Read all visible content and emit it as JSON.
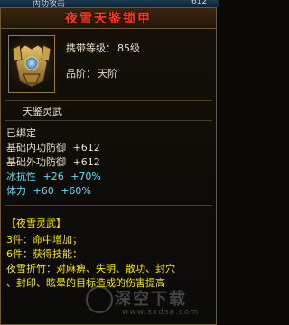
{
  "top_strip": {
    "text": "内功攻击",
    "num": "612"
  },
  "item": {
    "name": "夜雪天鉴锁甲",
    "icon": "armor-icon",
    "level_label": "携带等级：",
    "level_value": "85级",
    "grade_label": "品阶：",
    "grade_value": "天阶",
    "category": "天鉴灵武"
  },
  "stats": {
    "bound": "已绑定",
    "lines": [
      {
        "label": "基础内功防御",
        "value": "+612"
      },
      {
        "label": "基础外功防御",
        "value": "+612"
      },
      {
        "label": "冰抗性",
        "value": "+26",
        "extra": "+70%"
      },
      {
        "label": "体力",
        "value": "+60",
        "extra": "+60%"
      }
    ]
  },
  "set": {
    "title": "【夜雪灵武】",
    "bonus3": "3件：命中增加；",
    "bonus6": "6件：获得技能：",
    "skill_line1": "夜雪折竹：对麻痹、失明、散功、封穴",
    "skill_line2": "、封印、眩晕的目标造成的伤害提高"
  },
  "watermark": {
    "text": "深空下载",
    "site": "www.sxdsa.com"
  },
  "colors": {
    "title": "#ff3a1f",
    "cyan": "#5ce0ff",
    "yellow": "#f5e500"
  }
}
